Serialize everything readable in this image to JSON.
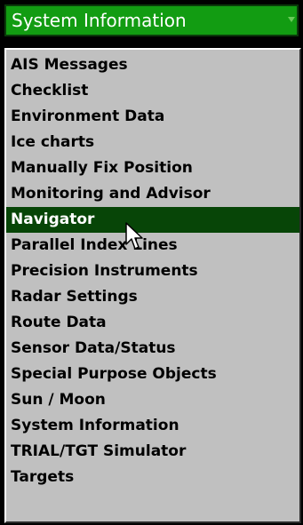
{
  "selector": {
    "label": "System Information",
    "icon": "chevron-down-icon",
    "background": "#129c12"
  },
  "list": {
    "selected_index": 6,
    "selected_background": "#074507",
    "items": [
      {
        "label": "AIS Messages"
      },
      {
        "label": "Checklist"
      },
      {
        "label": "Environment Data"
      },
      {
        "label": "Ice charts"
      },
      {
        "label": "Manually Fix Position"
      },
      {
        "label": "Monitoring and Advisor"
      },
      {
        "label": "Navigator"
      },
      {
        "label": "Parallel Index Lines"
      },
      {
        "label": "Precision Instruments"
      },
      {
        "label": "Radar Settings"
      },
      {
        "label": "Route Data"
      },
      {
        "label": "Sensor Data/Status"
      },
      {
        "label": "Special Purpose Objects"
      },
      {
        "label": "Sun / Moon"
      },
      {
        "label": "System Information"
      },
      {
        "label": "TRIAL/TGT Simulator"
      },
      {
        "label": "Targets"
      }
    ]
  },
  "cursor": {
    "icon": "mouse-pointer-icon"
  }
}
